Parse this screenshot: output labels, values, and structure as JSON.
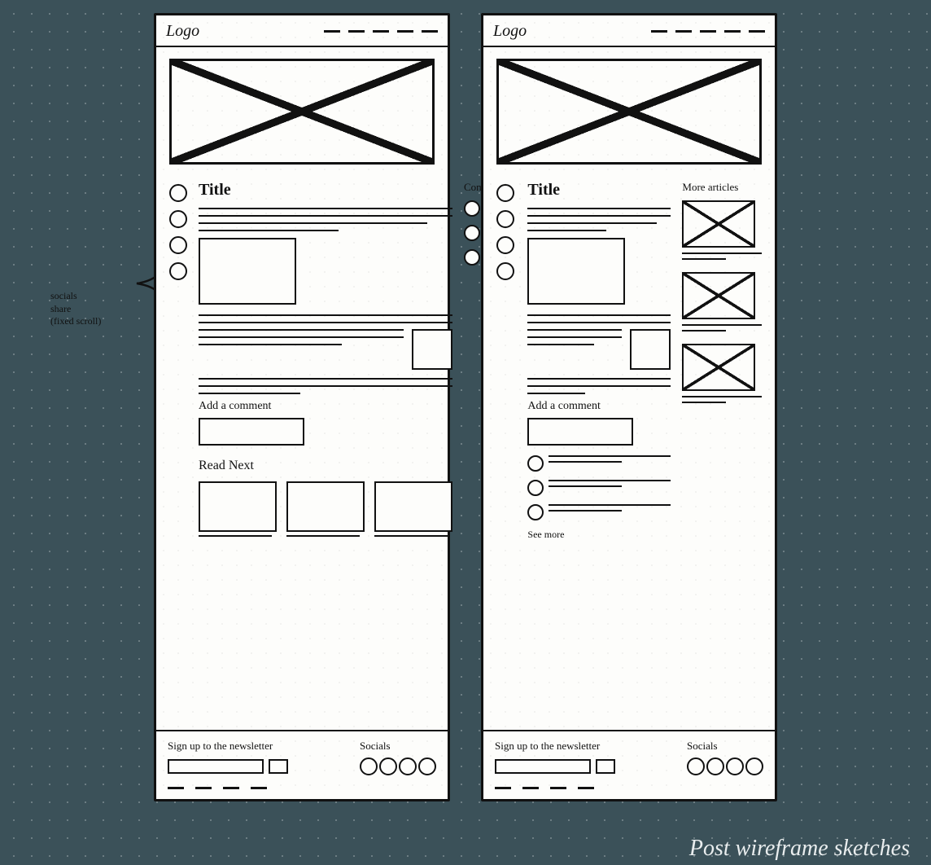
{
  "caption": "Post wireframe sketches",
  "annotation": {
    "line1": "socials",
    "line2": "share",
    "line3": "(fixed scroll)"
  },
  "frame_a": {
    "logo": "Logo",
    "nav_item_count": 5,
    "title": "Title",
    "aside_title": "Comments",
    "social_icon_count": 4,
    "comment_row_count": 3,
    "add_comment_label": "Add a comment",
    "read_next_label": "Read Next",
    "read_next_card_count": 3,
    "footer": {
      "newsletter_label": "Sign up to the newsletter",
      "socials_label": "Socials",
      "social_icon_count": 4,
      "footer_link_count": 4
    }
  },
  "frame_b": {
    "logo": "Logo",
    "nav_item_count": 5,
    "title": "Title",
    "aside_title": "More articles",
    "social_icon_count": 4,
    "more_article_count": 3,
    "add_comment_label": "Add a comment",
    "comment_list_count": 3,
    "see_more_label": "See more",
    "footer": {
      "newsletter_label": "Sign up to the newsletter",
      "socials_label": "Socials",
      "social_icon_count": 4,
      "footer_link_count": 4
    }
  }
}
